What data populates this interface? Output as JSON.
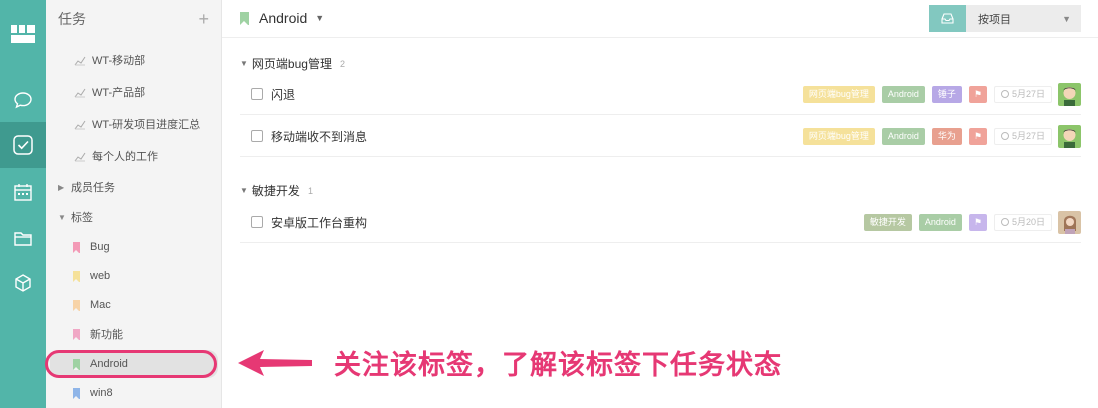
{
  "sidebar": {
    "title": "任务",
    "add_icon": "plus-icon",
    "reports": [
      {
        "label": "WT-移动部",
        "icon": "bar-chart-icon"
      },
      {
        "label": "WT-产品部",
        "icon": "bar-chart-icon"
      },
      {
        "label": "WT-研发项目进度汇总",
        "icon": "bar-chart-icon"
      },
      {
        "label": "每个人的工作",
        "icon": "bar-chart-icon"
      }
    ],
    "member_tasks": "成员任务",
    "tags_label": "标签",
    "tags": [
      {
        "label": "Bug",
        "color": "#f39ab6"
      },
      {
        "label": "web",
        "color": "#f5e19a"
      },
      {
        "label": "Mac",
        "color": "#f7d3a7"
      },
      {
        "label": "新功能",
        "color": "#f0a7c5"
      },
      {
        "label": "Android",
        "color": "#9fd2a3"
      },
      {
        "label": "win8",
        "color": "#8fb5e8"
      }
    ]
  },
  "header": {
    "title": "Android",
    "title_flag_color": "#9fd2a3",
    "sort_label": "按项目",
    "inbox_icon": "inbox-icon"
  },
  "sections": [
    {
      "name": "网页端bug管理",
      "count": "2",
      "tasks": [
        {
          "name": "闪退",
          "tags": [
            {
              "label": "网页端bug管理",
              "color": "#f5e19a"
            },
            {
              "label": "Android",
              "color": "#a9cda6"
            },
            {
              "label": "锤子",
              "color": "#b7a8e6"
            },
            {
              "label": "",
              "color": "#f0a39a"
            }
          ],
          "date": "5月27日"
        },
        {
          "name": "移动端收不到消息",
          "tags": [
            {
              "label": "网页端bug管理",
              "color": "#f5e19a"
            },
            {
              "label": "Android",
              "color": "#a9cda6"
            },
            {
              "label": "华为",
              "color": "#e8a08f"
            },
            {
              "label": "",
              "color": "#f0a39a"
            }
          ],
          "date": "5月27日"
        }
      ]
    },
    {
      "name": "敏捷开发",
      "count": "1",
      "tasks": [
        {
          "name": "安卓版工作台重构",
          "tags": [
            {
              "label": "敏捷开发",
              "color": "#b6c8a2"
            },
            {
              "label": "Android",
              "color": "#a9cda6"
            },
            {
              "label": "",
              "color": "#c7b6ec"
            }
          ],
          "date": "5月20日"
        }
      ]
    }
  ],
  "annotation": "关注该标签，了解该标签下任务状态"
}
